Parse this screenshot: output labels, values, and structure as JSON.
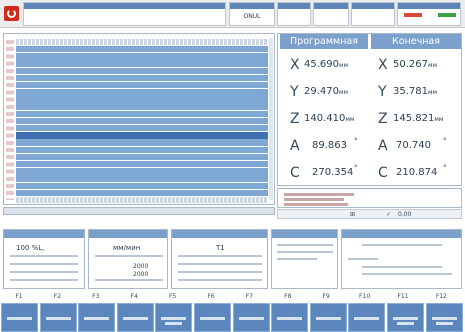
{
  "header": {
    "cell_2_value": "ONUL"
  },
  "positions": {
    "headers": [
      "Программная",
      "Конечная"
    ],
    "rows": [
      {
        "axis": "X",
        "programmed": "45.690",
        "actual": "50.267",
        "unit": "мм",
        "unit2": "мм"
      },
      {
        "axis": "Y",
        "programmed": "29.470",
        "actual": "35.781",
        "unit": "мм",
        "unit2": "мм"
      },
      {
        "axis": "Z",
        "programmed": "140.410",
        "actual": "145.821",
        "unit": "мм",
        "unit2": "мм"
      },
      {
        "axis": "A",
        "programmed": "89.863",
        "actual": "70.740",
        "unit": "°",
        "unit2": "°"
      },
      {
        "axis": "C",
        "programmed": "270.354",
        "actual": "210.874",
        "unit": "°",
        "unit2": "°"
      }
    ]
  },
  "tools": {
    "value": "0,00"
  },
  "spindle": {
    "feed": "100 %L,",
    "s_label": "мм/мин",
    "tool_no": "T1",
    "f_value": "2000",
    "s_value": "2000"
  },
  "fkeys": [
    "F1",
    "F2",
    "F3",
    "F4",
    "F5",
    "F6",
    "F7",
    "F8",
    "F9",
    "F10",
    "F11",
    "F12"
  ],
  "colors": {
    "accent": "#5b87be",
    "header_blue": "#7ba0cb",
    "selection": "#7fa7d3",
    "logo_red": "#d32a1e"
  }
}
